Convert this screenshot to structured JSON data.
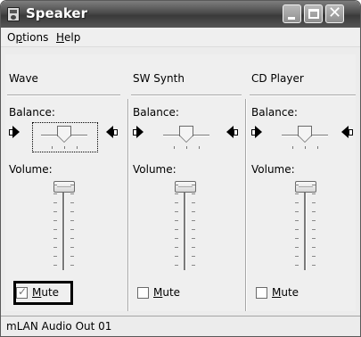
{
  "window": {
    "title": "Speaker",
    "icon": "speaker-app-icon",
    "buttons": [
      "minimize-button",
      "maximize-button",
      "close-button"
    ]
  },
  "menu": {
    "options": {
      "prefix": "O",
      "accel": "p",
      "rest": "tions"
    },
    "help": {
      "accel": "H",
      "rest": "elp"
    }
  },
  "channels": [
    {
      "name": "Wave",
      "balance_label": "Balance:",
      "balance_fraction": 0.5,
      "volume_label": "Volume:",
      "volume_fraction": 1.0,
      "mute_label_accel": "M",
      "mute_label_rest": "ute",
      "mute_checked": true,
      "mute_check_glyph": "✓",
      "focused": true
    },
    {
      "name": "SW Synth",
      "balance_label": "Balance:",
      "balance_fraction": 0.5,
      "volume_label": "Volume:",
      "volume_fraction": 1.0,
      "mute_label_accel": "M",
      "mute_label_rest": "ute",
      "mute_checked": false,
      "focused": false
    },
    {
      "name": "CD Player",
      "balance_label": "Balance:",
      "balance_fraction": 0.5,
      "volume_label": "Volume:",
      "volume_fraction": 1.0,
      "mute_label_accel": "M",
      "mute_label_rest": "ute",
      "mute_checked": false,
      "focused": false
    }
  ],
  "status": {
    "text": "mLAN Audio Out 01"
  },
  "colors": {
    "title_bar": "#4b4b4b",
    "highlight_outline": "#000000"
  }
}
